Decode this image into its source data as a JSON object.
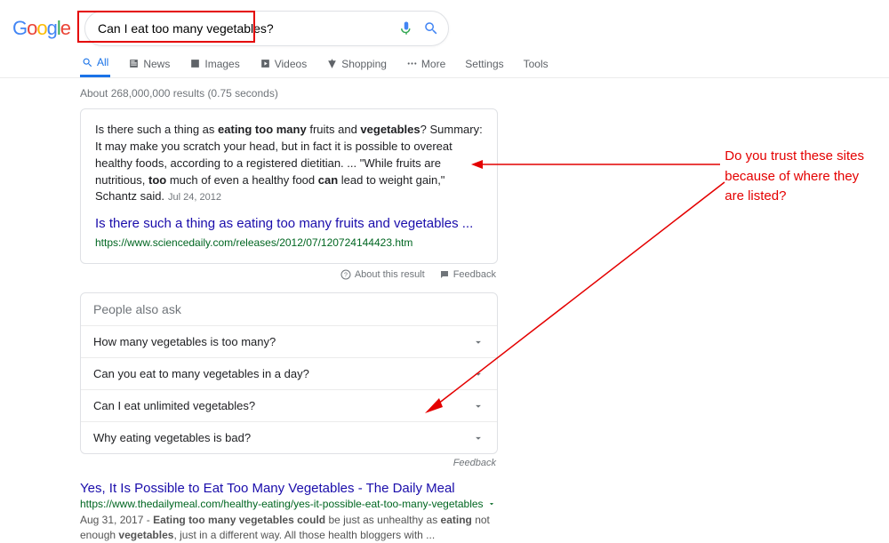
{
  "search": {
    "query": "Can I eat too many vegetables?"
  },
  "tabs": {
    "all": "All",
    "news": "News",
    "images": "Images",
    "videos": "Videos",
    "shopping": "Shopping",
    "more": "More",
    "settings": "Settings",
    "tools": "Tools"
  },
  "stats": "About 268,000,000 results (0.75 seconds)",
  "featured": {
    "text_pre": "Is there such a thing as ",
    "b1": "eating too many",
    "text_mid1": " fruits and ",
    "b2": "vegetables",
    "text_mid2": "? Summary: It may make you scratch your head, but in fact it is possible to overeat healthy foods, according to a registered dietitian. ... \"While fruits are nutritious, ",
    "b3": "too",
    "text_mid3": " much of even a healthy food ",
    "b4": "can",
    "text_end": " lead to weight gain,\" Schantz said.",
    "date": "Jul 24, 2012",
    "title": "Is there such a thing as eating too many fruits and vegetables ...",
    "url": "https://www.sciencedaily.com/releases/2012/07/120724144423.htm",
    "about": "About this result",
    "feedback": "Feedback"
  },
  "paa": {
    "header": "People also ask",
    "q1": "How many vegetables is too many?",
    "q2": "Can you eat to many vegetables in a day?",
    "q3": "Can I eat unlimited vegetables?",
    "q4": "Why eating vegetables is bad?",
    "feedback": "Feedback"
  },
  "result1": {
    "title": "Yes, It Is Possible to Eat Too Many Vegetables - The Daily Meal",
    "url": "https://www.thedailymeal.com/healthy-eating/yes-it-possible-eat-too-many-vegetables",
    "date": "Aug 31, 2017 - ",
    "b1": "Eating too many vegetables could",
    "mid1": " be just as unhealthy as ",
    "b2": "eating",
    "mid2": " not enough ",
    "b3": "vegetables",
    "end": ", just in a different way. All those health bloggers with ..."
  },
  "annotation": {
    "l1": "Do you trust these sites",
    "l2": "because of where they",
    "l3": "are listed?"
  }
}
